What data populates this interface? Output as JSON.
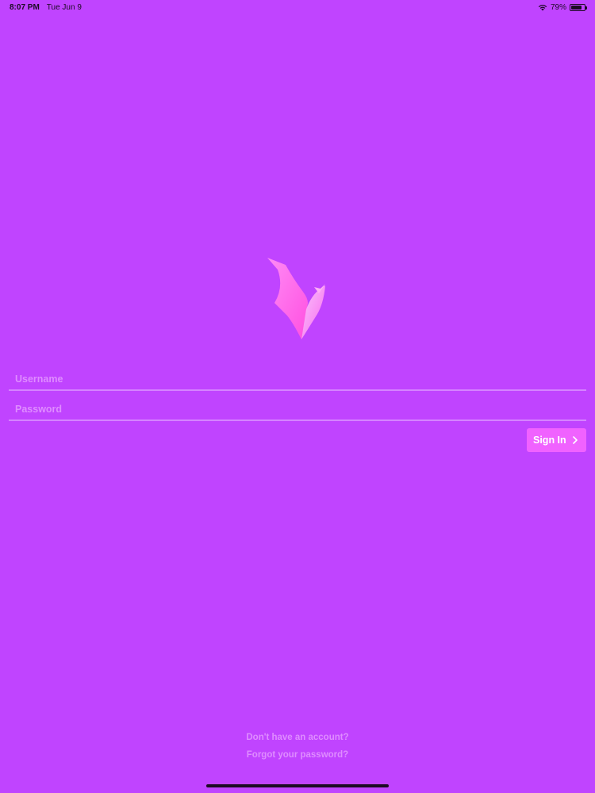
{
  "status_bar": {
    "time": "8:07 PM",
    "date": "Tue Jun 9",
    "battery_percent_label": "79%",
    "battery_level": 0.79
  },
  "login": {
    "username_placeholder": "Username",
    "password_placeholder": "Password",
    "signin_label": "Sign In"
  },
  "links": {
    "no_account": "Don't have an account?",
    "forgot_password": "Forgot your password?"
  },
  "colors": {
    "background": "#c044ff",
    "button": "#f062ff",
    "placeholder": "#df8cff",
    "underline": "#d583ff"
  },
  "icons": {
    "logo": "pink-bird-logo",
    "button_icon": "chevron-right-icon",
    "wifi": "wifi-icon",
    "battery": "battery-icon"
  }
}
